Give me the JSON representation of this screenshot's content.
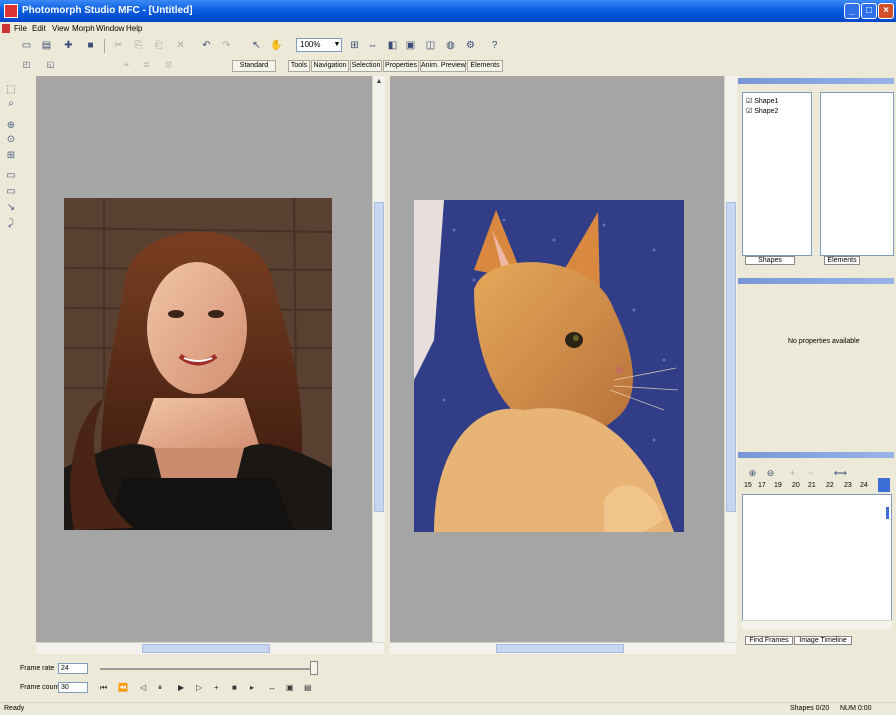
{
  "window": {
    "title": "Photomorph Studio MFC - [Untitled]",
    "min_glyph": "_",
    "max_glyph": "□",
    "close_glyph": "×"
  },
  "menu": [
    "File",
    "Edit",
    "View",
    "Morph",
    "Window",
    "Help"
  ],
  "toolbar": {
    "zoom_value": "100%",
    "zoom_arrow": "▼"
  },
  "tabs": [
    "Standard",
    "Tools",
    "Navigation",
    "Selection",
    "Properties",
    "Anim. Preview",
    "Elements"
  ],
  "objects_panel": {
    "items": [
      "Shape1",
      "Shape2"
    ],
    "tabs": [
      "Shapes",
      "Elements"
    ]
  },
  "properties_panel": {
    "message": "No properties available"
  },
  "timeline_panel": {
    "frame_numbers": [
      "15",
      "17",
      "19",
      "20",
      "21",
      "22",
      "23",
      "24"
    ],
    "tabs": [
      "Find Frames",
      "Image Timeline"
    ]
  },
  "bottom": {
    "frame_rate_label": "Frame rate",
    "frame_rate_value": "24",
    "frame_count_label": "Frame count",
    "frame_count_value": "30"
  },
  "status": {
    "left": "Ready",
    "middle": "Shapes 0/20",
    "right": "NUM 0:00"
  },
  "colors": {
    "titlebar": "#0a5ee0",
    "view_bg": "#a5a5a5",
    "chrome": "#ece9d8"
  }
}
